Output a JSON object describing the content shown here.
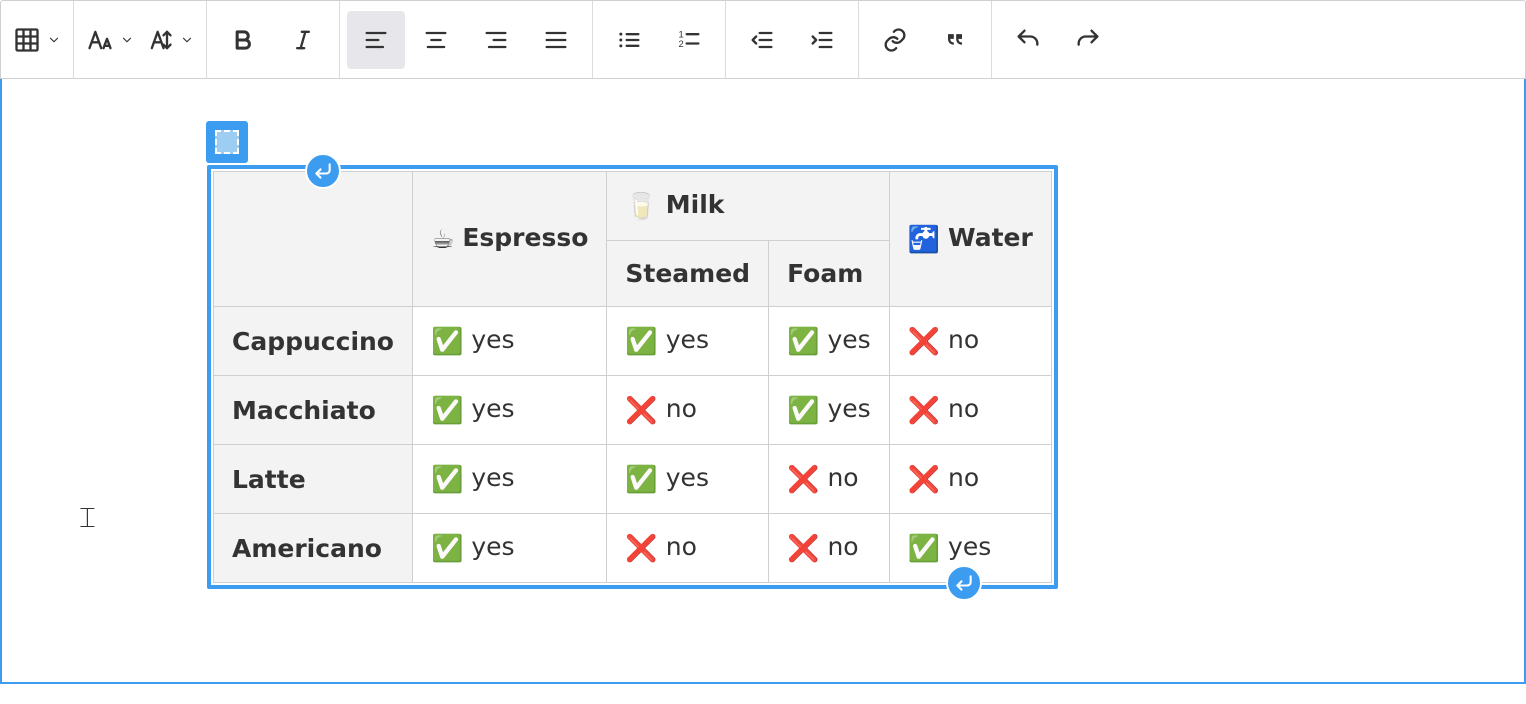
{
  "toolbar": {
    "table_tooltip": "Insert table",
    "font_size_tooltip": "Font size",
    "line_height_tooltip": "Line height",
    "bold_tooltip": "Bold",
    "italic_tooltip": "Italic",
    "align_left_tooltip": "Align left",
    "align_center_tooltip": "Align center",
    "align_right_tooltip": "Align right",
    "align_justify_tooltip": "Justify",
    "bulleted_list_tooltip": "Bulleted list",
    "numbered_list_tooltip": "Numbered list",
    "indent_decrease_tooltip": "Decrease indent",
    "indent_increase_tooltip": "Increase indent",
    "link_tooltip": "Link",
    "blockquote_tooltip": "Block quote",
    "undo_tooltip": "Undo",
    "redo_tooltip": "Redo"
  },
  "table": {
    "headers": {
      "blank": "",
      "espresso_emoji": "☕",
      "espresso_label": "Espresso",
      "milk_emoji": "🥛",
      "milk_label": "Milk",
      "steamed_label": "Steamed",
      "foam_label": "Foam",
      "water_emoji": "🚰",
      "water_label": "Water"
    },
    "yes_emoji": "✅",
    "no_emoji": "❌",
    "yes_label": "yes",
    "no_label": "no",
    "rows": [
      {
        "name": "Cappuccino",
        "espresso": "yes",
        "steamed": "yes",
        "foam": "yes",
        "water": "no"
      },
      {
        "name": "Macchiato",
        "espresso": "yes",
        "steamed": "no",
        "foam": "yes",
        "water": "no"
      },
      {
        "name": "Latte",
        "espresso": "yes",
        "steamed": "yes",
        "foam": "no",
        "water": "no"
      },
      {
        "name": "Americano",
        "espresso": "yes",
        "steamed": "no",
        "foam": "no",
        "water": "yes"
      }
    ]
  }
}
